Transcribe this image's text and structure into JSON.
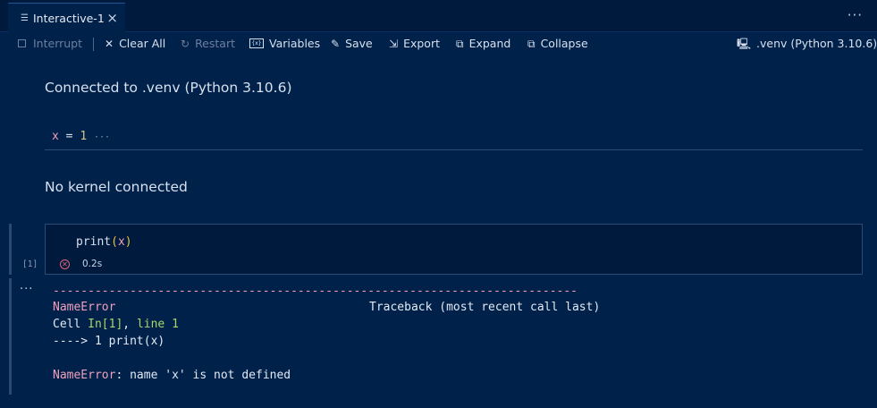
{
  "tab": {
    "title": "Interactive-1"
  },
  "toolbar": {
    "interrupt": "Interrupt",
    "clear_all": "Clear All",
    "restart": "Restart",
    "variables": "Variables",
    "save": "Save",
    "export": "Export",
    "expand": "Expand",
    "collapse": "Collapse",
    "kernel": ".venv (Python 3.10.6)"
  },
  "messages": {
    "connected": "Connected to .venv (Python 3.10.6)",
    "no_kernel": "No kernel connected"
  },
  "cell1": {
    "var": "x",
    "op": " = ",
    "value": "1",
    "ellipsis": "···"
  },
  "cell2": {
    "func": "print",
    "open": "(",
    "arg": "x",
    "close": ")",
    "exec_count": "[1]",
    "duration": "0.2s"
  },
  "output": {
    "dashes": "---------------------------------------------------------------------------",
    "error_name": "NameError",
    "traceback_header": "Traceback (most recent call last)",
    "cell_prefix": "Cell ",
    "cell_ref": "In[1]",
    "cell_sep": ", ",
    "cell_line": "line 1",
    "arrow_line": "----> 1 print(x)",
    "error_message": ": name 'x' is not defined"
  },
  "colors": {
    "background": "#00214a",
    "error_red": "#f0a0bd",
    "green": "#a9d56b"
  }
}
